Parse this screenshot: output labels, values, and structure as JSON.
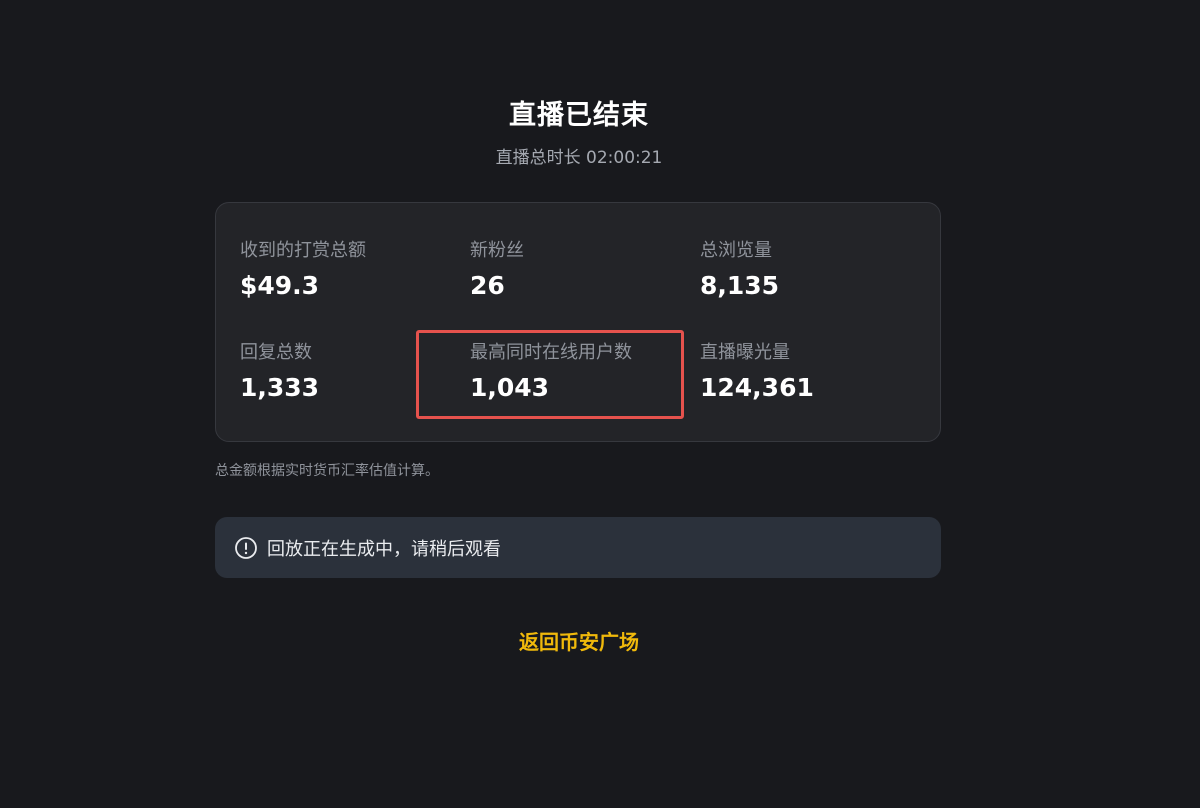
{
  "header": {
    "title": "直播已结束",
    "duration_text": "直播总时长 02:00:21"
  },
  "stats": {
    "tips_total": {
      "label": "收到的打赏总额",
      "value": "$49.3"
    },
    "new_followers": {
      "label": "新粉丝",
      "value": "26"
    },
    "total_views": {
      "label": "总浏览量",
      "value": "8,135"
    },
    "total_replies": {
      "label": "回复总数",
      "value": "1,333"
    },
    "peak_concurrent_users": {
      "label": "最高同时在线用户数",
      "value": "1,043"
    },
    "live_impressions": {
      "label": "直播曝光量",
      "value": "124,361"
    }
  },
  "note": "总金额根据实时货币汇率估值计算。",
  "replay_banner": {
    "icon": "info-icon",
    "text": "回放正在生成中，请稍后观看"
  },
  "back_link": {
    "label": "返回币安广场"
  },
  "colors": {
    "background": "#18191d",
    "card": "#232428",
    "banner": "#2b313b",
    "accent": "#f0b90b",
    "highlight": "#e5524d",
    "muted_text": "#8f939b"
  }
}
